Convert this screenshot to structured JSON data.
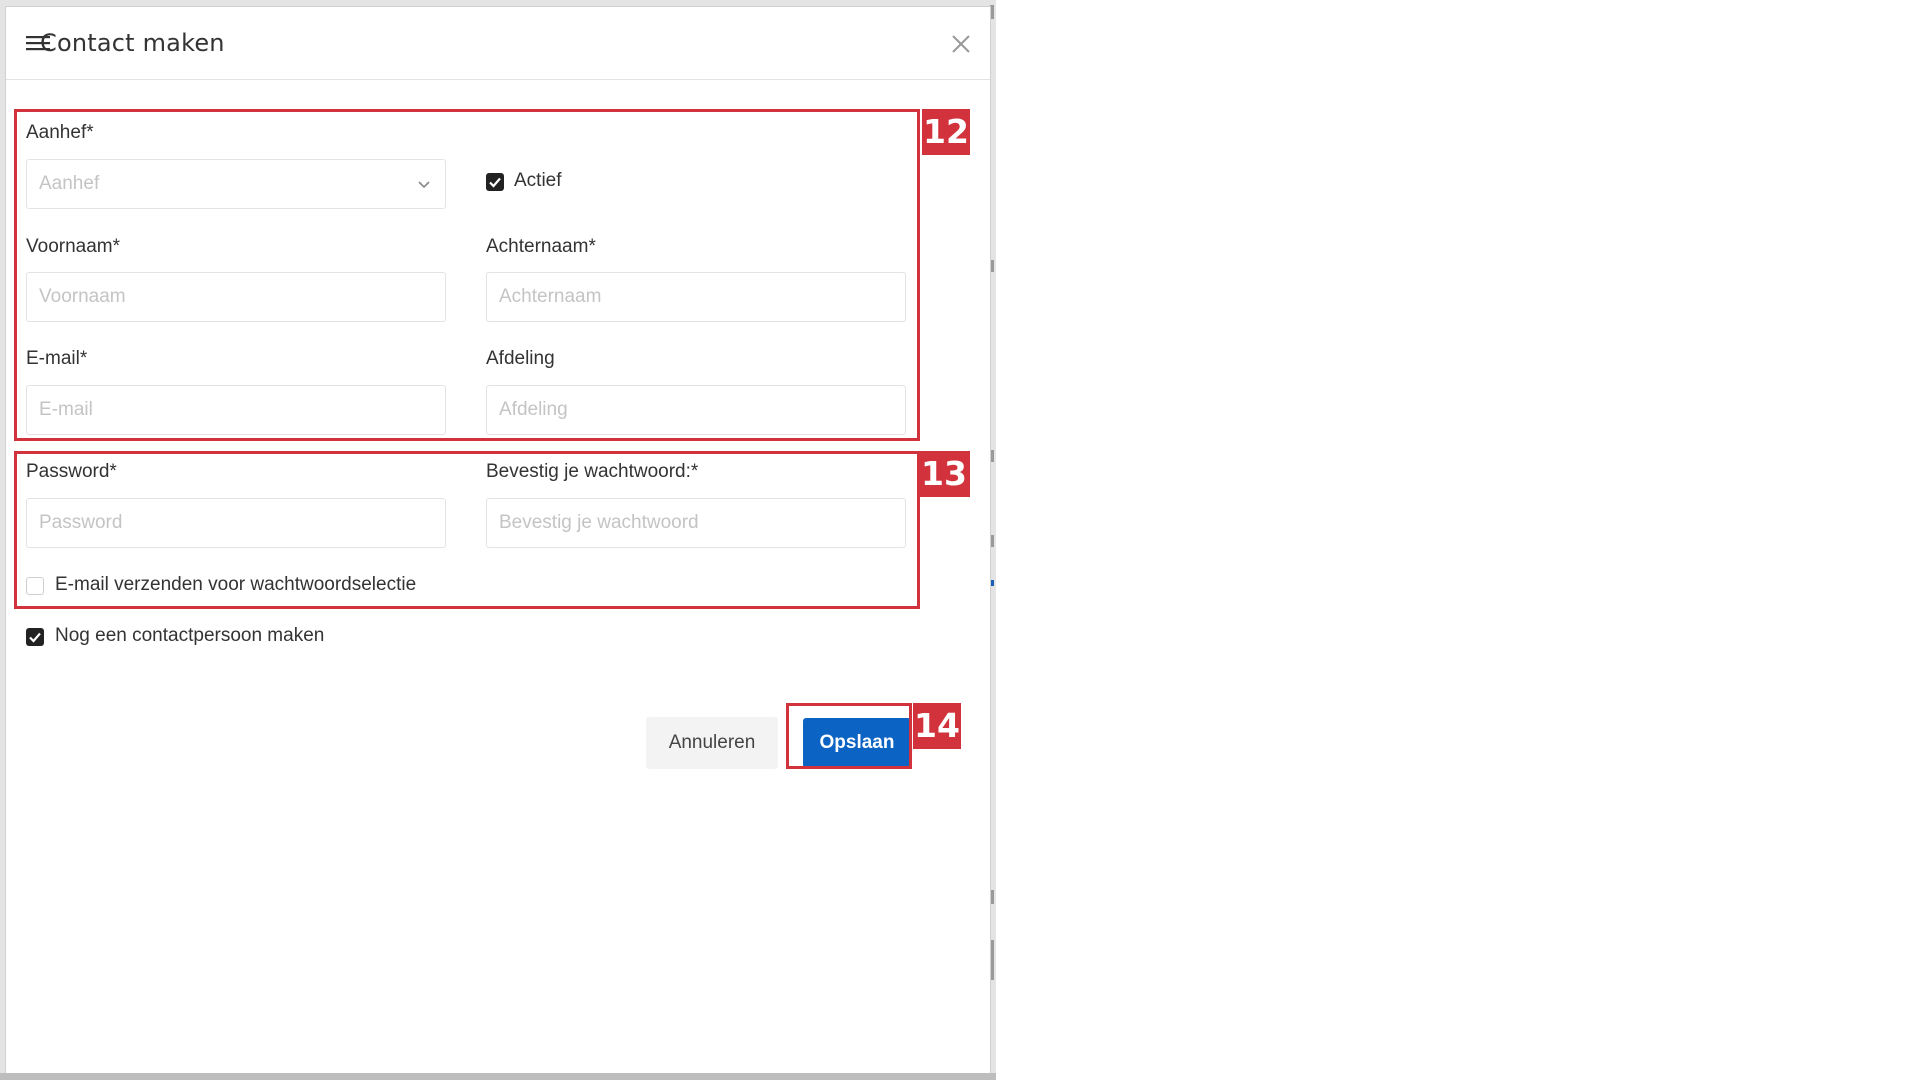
{
  "modal": {
    "title": "Contact maken",
    "close_icon": "close-icon"
  },
  "form": {
    "salutation": {
      "label": "Aanhef*",
      "placeholder": "Aanhef"
    },
    "active": {
      "label": "Actief",
      "checked": true
    },
    "first_name": {
      "label": "Voornaam*",
      "placeholder": "Voornaam"
    },
    "last_name": {
      "label": "Achternaam*",
      "placeholder": "Achternaam"
    },
    "email": {
      "label": "E-mail*",
      "placeholder": "E-mail"
    },
    "department": {
      "label": "Afdeling",
      "placeholder": "Afdeling"
    },
    "password": {
      "label": "Password*",
      "placeholder": "Password"
    },
    "confirm_password": {
      "label": "Bevestig je wachtwoord:*",
      "placeholder": "Bevestig je wachtwoord"
    },
    "send_email": {
      "label": "E-mail verzenden voor wachtwoordselectie",
      "checked": false
    },
    "create_another": {
      "label": "Nog een contactpersoon maken",
      "checked": true
    }
  },
  "actions": {
    "cancel_label": "Annuleren",
    "save_label": "Opslaan"
  },
  "annotations": [
    {
      "number": "12"
    },
    {
      "number": "13"
    },
    {
      "number": "14"
    }
  ],
  "colors": {
    "primary": "#0b63c4",
    "annotation": "#d2323c",
    "checkbox": "#222222"
  }
}
